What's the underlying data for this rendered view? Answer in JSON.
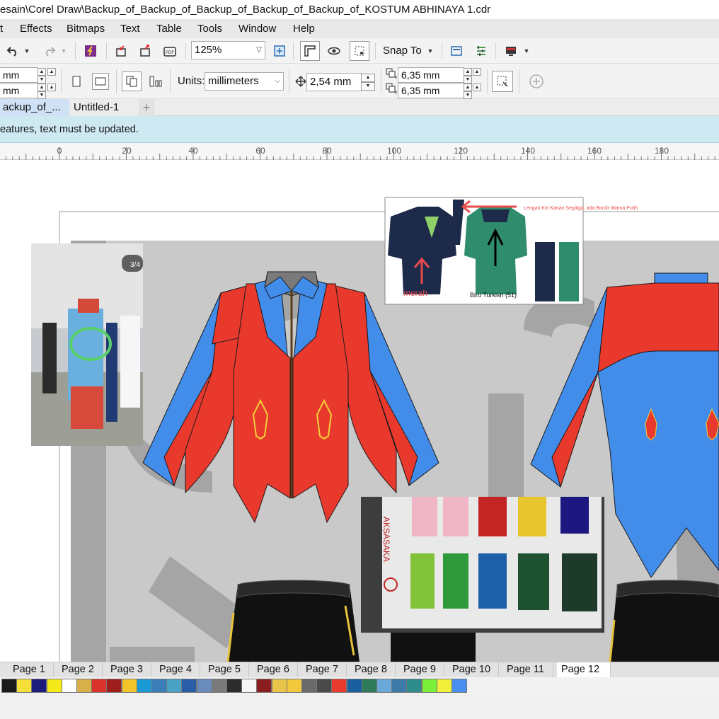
{
  "window": {
    "title": "esain\\Corel Draw\\Backup_of_Backup_of_Backup_of_Backup_of_Backup_of_KOSTUM ABHINAYA 1.cdr"
  },
  "menu": {
    "items": [
      "t",
      "Effects",
      "Bitmaps",
      "Text",
      "Table",
      "Tools",
      "Window",
      "Help"
    ]
  },
  "toolbar": {
    "zoom": "125%",
    "snap_to": "Snap To"
  },
  "property_bar": {
    "width_value": "mm",
    "height_value": "mm",
    "units_label": "Units:",
    "units_value": "millimeters",
    "nudge_value": "2,54 mm",
    "dup_x_value": "6,35 mm",
    "dup_y_value": "6,35 mm"
  },
  "doc_tabs": [
    "ackup_of_...",
    "Untitled-1"
  ],
  "info_bar": {
    "message": "eatures, text must be updated."
  },
  "ruler": {
    "labels": [
      "0",
      "20",
      "40",
      "60",
      "80",
      "100",
      "120",
      "140",
      "160",
      "180"
    ]
  },
  "reference": {
    "photo_counter": "3/4",
    "annotation_top": "Lengan Kiri Kanan Segitiga, ada Bordir Warna Putih",
    "annotation_merah": "merah",
    "annotation_biru": "Biru Turkish (51)",
    "swatch_brand": "AKSASAKA"
  },
  "page_tabs": [
    "Page 1",
    "Page 2",
    "Page 3",
    "Page 4",
    "Page 5",
    "Page 6",
    "Page 7",
    "Page 8",
    "Page 9",
    "Page 10",
    "Page 11",
    "Page 12"
  ],
  "palette": [
    "#1a1a1a",
    "#f5e03a",
    "#1c1c7a",
    "#f4ea1a",
    "#ffffff",
    "#d8b04a",
    "#d9332b",
    "#9e1e1e",
    "#f3c52a",
    "#1c9ad6",
    "#3c7fb8",
    "#4aa2c4",
    "#2a5fa8",
    "#6a8cbc",
    "#7a7a7a",
    "#2c2c2c",
    "#f6f6f6",
    "#8a1d1d",
    "#e8c54a",
    "#f2c83c",
    "#6a6a6a",
    "#4a4a4a",
    "#e63b2e",
    "#1a5fa0",
    "#2f7a58",
    "#6aa8d8",
    "#3d7aa8",
    "#2f8c8c",
    "#7af03a",
    "#f0f03a",
    "#4a8ef0"
  ],
  "colors": {
    "jacket_red": "#e9382c",
    "jacket_blue": "#428cea",
    "background_gray": "#c9c9c9",
    "watermark_gray": "#a5a5a5",
    "info_bar": "#cfe9f3"
  }
}
